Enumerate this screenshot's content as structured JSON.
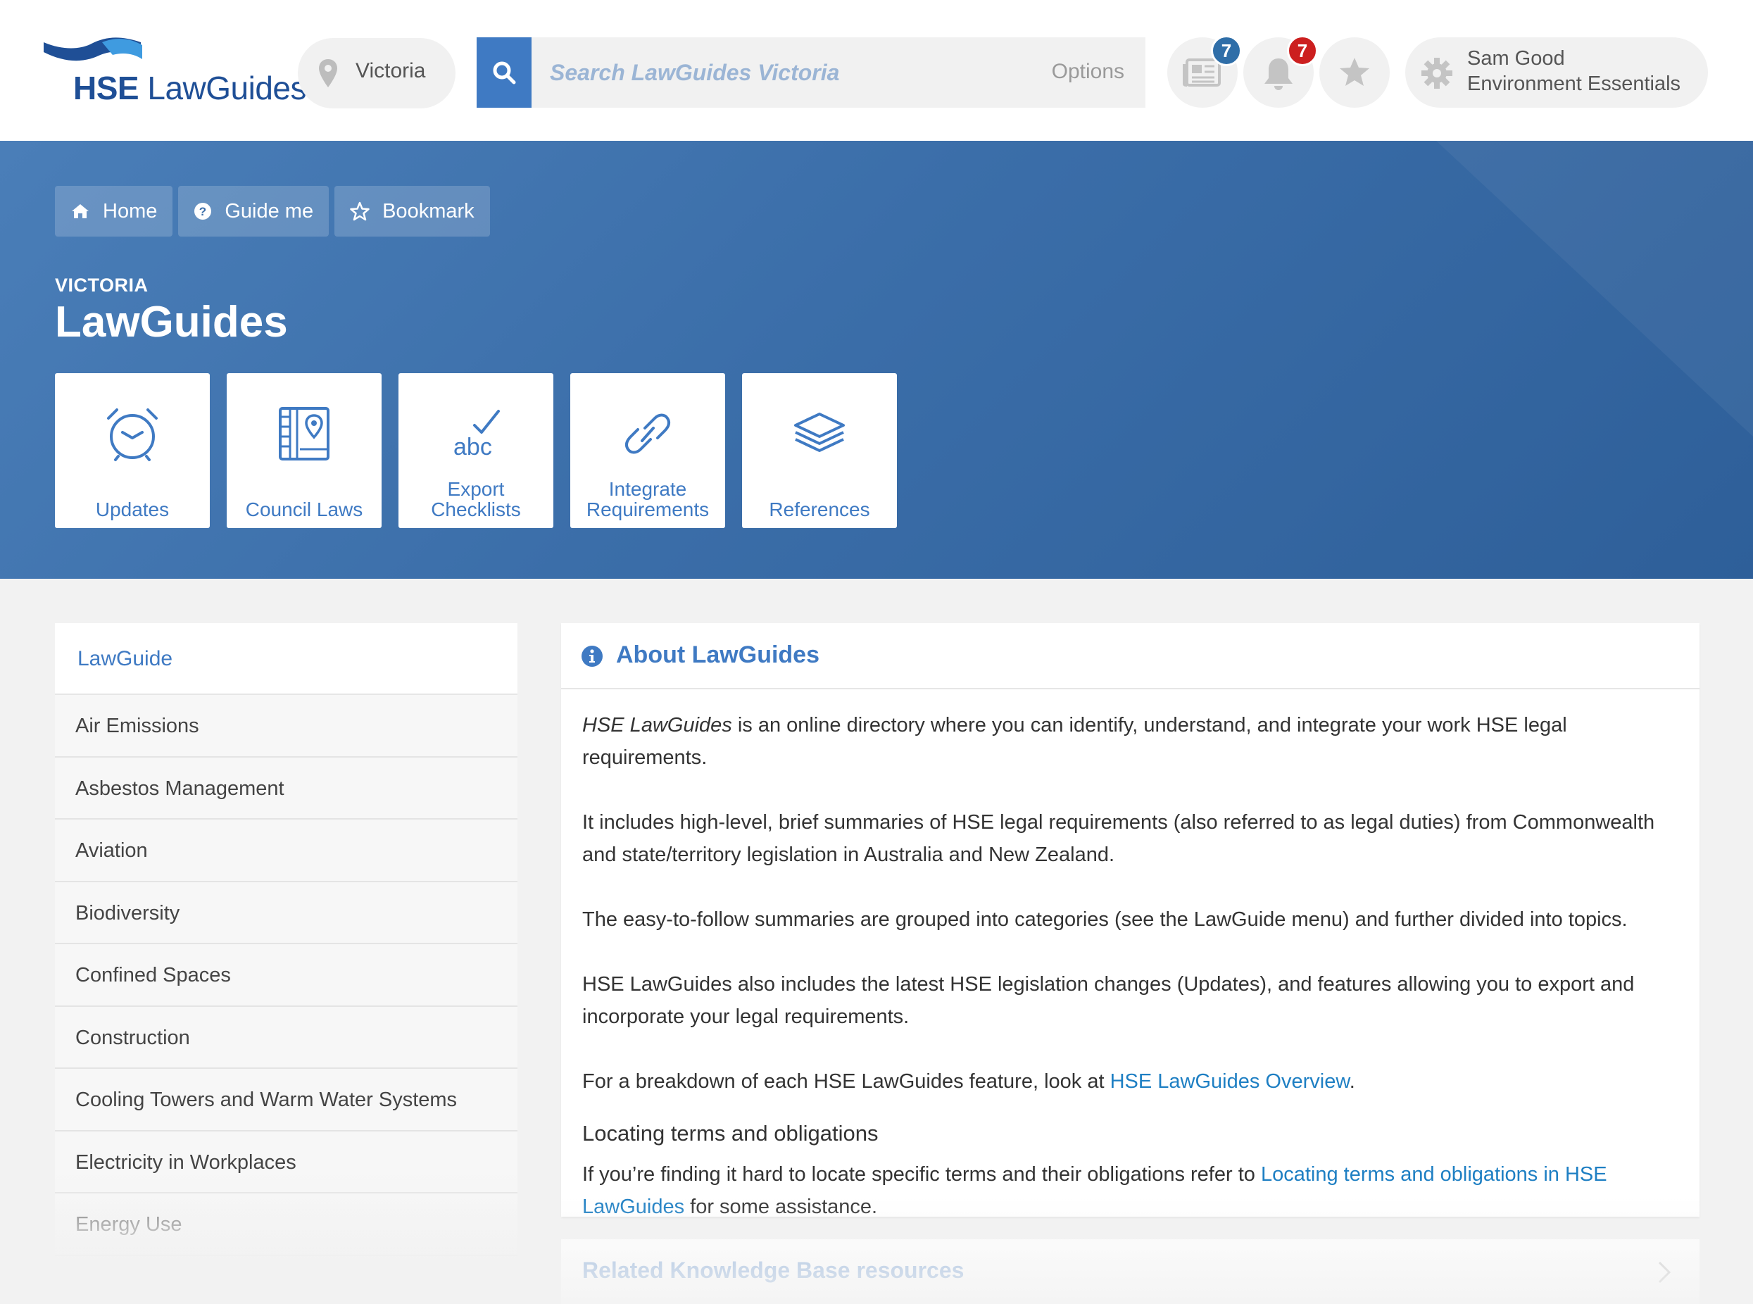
{
  "brand": {
    "logo_prefix": "HSE",
    "logo_suffix": " LawGuides",
    "logo_icon": "wave-logo-icon",
    "primary": "#3f7ac3",
    "dark": "#1f4f96"
  },
  "location": {
    "icon": "map-pin-icon",
    "label": "Victoria"
  },
  "search": {
    "placeholder": "Search LawGuides Victoria",
    "options_label": "Options",
    "icon": "search-icon"
  },
  "header_icons": {
    "news": {
      "icon": "newspaper-icon",
      "count": "7",
      "badge_color": "#2f6ea8"
    },
    "alerts": {
      "icon": "bell-icon",
      "count": "7",
      "badge_color": "#cc1f1f"
    },
    "favourites": {
      "icon": "star-icon"
    }
  },
  "user": {
    "icon": "gear-icon",
    "name": "Sam Good",
    "subscription": "Environment Essentials"
  },
  "breadcrumbs": [
    {
      "icon": "home-icon",
      "label": "Home"
    },
    {
      "icon": "question-circle-icon",
      "label": "Guide me"
    },
    {
      "icon": "star-outline-icon",
      "label": "Bookmark"
    }
  ],
  "hero": {
    "subtitle": "VICTORIA",
    "title": "LawGuides"
  },
  "tiles": [
    {
      "icon": "alarm-clock-icon",
      "label": "Updates"
    },
    {
      "icon": "map-book-icon",
      "label": "Council Laws"
    },
    {
      "icon": "abc-check-icon",
      "label": "Export Checklists"
    },
    {
      "icon": "link-icon",
      "label": "Integrate Requirements"
    },
    {
      "icon": "layers-icon",
      "label": "References"
    }
  ],
  "sidebar": {
    "title": "LawGuide",
    "items": [
      "Air Emissions",
      "Asbestos Management",
      "Aviation",
      "Biodiversity",
      "Confined Spaces",
      "Construction",
      "Cooling Towers and Warm Water Systems",
      "Electricity in Workplaces",
      "Energy Use"
    ]
  },
  "about": {
    "icon": "info-circle-icon",
    "title": "About LawGuides",
    "p1_em": "HSE LawGuides",
    "p1_rest": " is an online directory where you can identify, understand, and integrate your work HSE legal requirements.",
    "p2": "It includes high-level, brief summaries of HSE legal requirements (also referred to as legal duties) from Commonwealth and state/territory legislation in Australia and New Zealand.",
    "p3": "The easy-to-follow summaries are grouped into categories (see the LawGuide menu) and further divided into topics.",
    "p4": "HSE LawGuides also includes the latest HSE legislation changes (Updates), and features allowing you to export and incorporate your legal requirements.",
    "p5_pre": "For a breakdown of each HSE LawGuides feature, look at ",
    "p5_link": "HSE LawGuides Overview",
    "p5_post": ".",
    "h_locating": "Locating terms and obligations",
    "p6_pre": "If you’re finding it hard to locate specific terms and their obligations refer to ",
    "p6_link": "Locating terms and obligations in HSE LawGuides",
    "p6_post": " for some assistance."
  },
  "related": {
    "title": "Related Knowledge Base resources",
    "icon": "chevron-right-icon"
  }
}
